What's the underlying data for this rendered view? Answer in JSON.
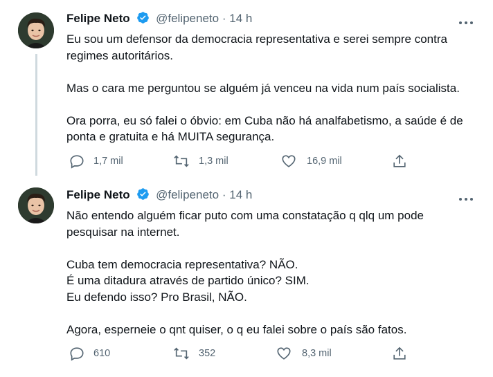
{
  "tweets": [
    {
      "author_name": "Felipe Neto",
      "handle": "@felipeneto",
      "separator": "·",
      "time": "14 h",
      "lines": [
        "Eu sou um defensor da democracia representativa e serei sempre contra",
        "regimes autoritários.",
        "",
        "Mas o cara me perguntou se alguém já venceu na vida num país socialista.",
        "",
        "Ora porra, eu só falei o óbvio: em Cuba não há analfabetismo, a saúde é de",
        "ponta e gratuita e há MUITA segurança."
      ],
      "replies": "1,7 mil",
      "retweets": "1,3 mil",
      "likes": "16,9 mil"
    },
    {
      "author_name": "Felipe Neto",
      "handle": "@felipeneto",
      "separator": "·",
      "time": "14 h",
      "lines": [
        "Não entendo alguém ficar puto com uma constatação q qlq um pode",
        "pesquisar na internet.",
        "",
        "Cuba tem democracia representativa? NÃO.",
        "É uma ditadura através de partido único? SIM.",
        "Eu defendo isso? Pro Brasil, NÃO.",
        "",
        "Agora, esperneie o qnt quiser, o q eu falei sobre o país são fatos."
      ],
      "replies": "610",
      "retweets": "352",
      "likes": "8,3 mil"
    }
  ],
  "colors": {
    "text": "#0f1419",
    "muted": "#536471",
    "verified": "#1d9bf0",
    "thread_line": "#cfd9de"
  }
}
